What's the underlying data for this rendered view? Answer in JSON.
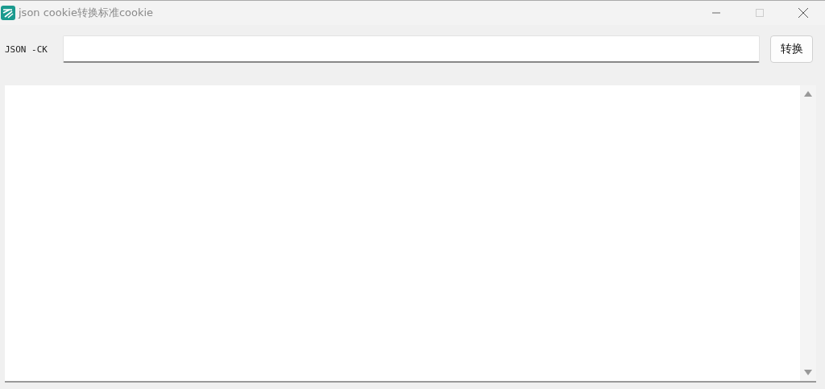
{
  "window": {
    "title": "json cookie转换标准cookie",
    "maximize_disabled": true
  },
  "input_row": {
    "label": "JSON -CK",
    "button": "转换"
  }
}
